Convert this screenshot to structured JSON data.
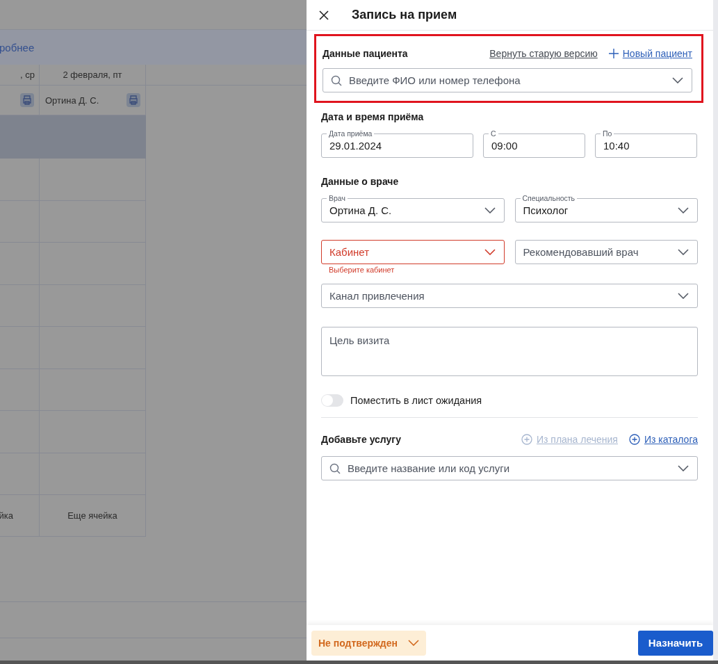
{
  "background": {
    "link": "робнее",
    "table": {
      "columns": [
        ", ср",
        "2 февраля, пт"
      ],
      "rows": [
        {
          "kind": "doctor",
          "cells": [
            {
              "print": true
            },
            {
              "text": "Ортина Д. С.",
              "print": true
            }
          ]
        },
        {
          "kind": "band"
        },
        {
          "kind": "empty"
        },
        {
          "kind": "empty"
        },
        {
          "kind": "empty"
        },
        {
          "kind": "empty"
        },
        {
          "kind": "empty"
        },
        {
          "kind": "empty"
        },
        {
          "kind": "empty"
        },
        {
          "kind": "empty"
        },
        {
          "kind": "text",
          "cells": [
            {
              "text": "йка"
            },
            {
              "text": "Еще ячейка"
            }
          ]
        }
      ]
    }
  },
  "drawer": {
    "title": "Запись на прием",
    "patient": {
      "title": "Данные пациента",
      "highlighted": true,
      "links": [
        {
          "label": "Вернуть старую версию",
          "kind": "plain"
        },
        {
          "label": "Новый пациент",
          "kind": "add"
        }
      ],
      "search": {
        "placeholder": "Введите ФИО или номер телефона"
      }
    },
    "datetime": {
      "title": "Дата и время приёма",
      "fields": [
        {
          "label": "Дата приёма",
          "value": "29.01.2024"
        },
        {
          "label": "С",
          "value": "09:00"
        },
        {
          "label": "По",
          "value": "10:40"
        }
      ]
    },
    "doctor": {
      "title": "Данные о враче",
      "fields": [
        {
          "label": "Врач",
          "value": "Ортина Д. С.",
          "invalid": false
        },
        {
          "label": "Специальность",
          "value": "Психолог",
          "invalid": false
        },
        {
          "placeholder": "Кабинет",
          "invalid": true,
          "error": "Выберите кабинет"
        },
        {
          "placeholder": "Рекомендовавший врач",
          "invalid": false
        },
        {
          "placeholder": "Канал привлечения",
          "invalid": false,
          "wide": true
        }
      ]
    },
    "goal": {
      "placeholder": "Цель визита"
    },
    "waitlist": {
      "label": "Поместить в лист ожидания",
      "on": false
    },
    "services": {
      "title": "Добавьте услугу",
      "links": [
        {
          "label": "Из плана лечения",
          "disabled": true
        },
        {
          "label": "Из каталога",
          "disabled": false
        }
      ],
      "search": {
        "placeholder": "Введите название или код услуги"
      }
    },
    "footer": {
      "status": "Не подтвержден",
      "button": "Назначить"
    }
  }
}
